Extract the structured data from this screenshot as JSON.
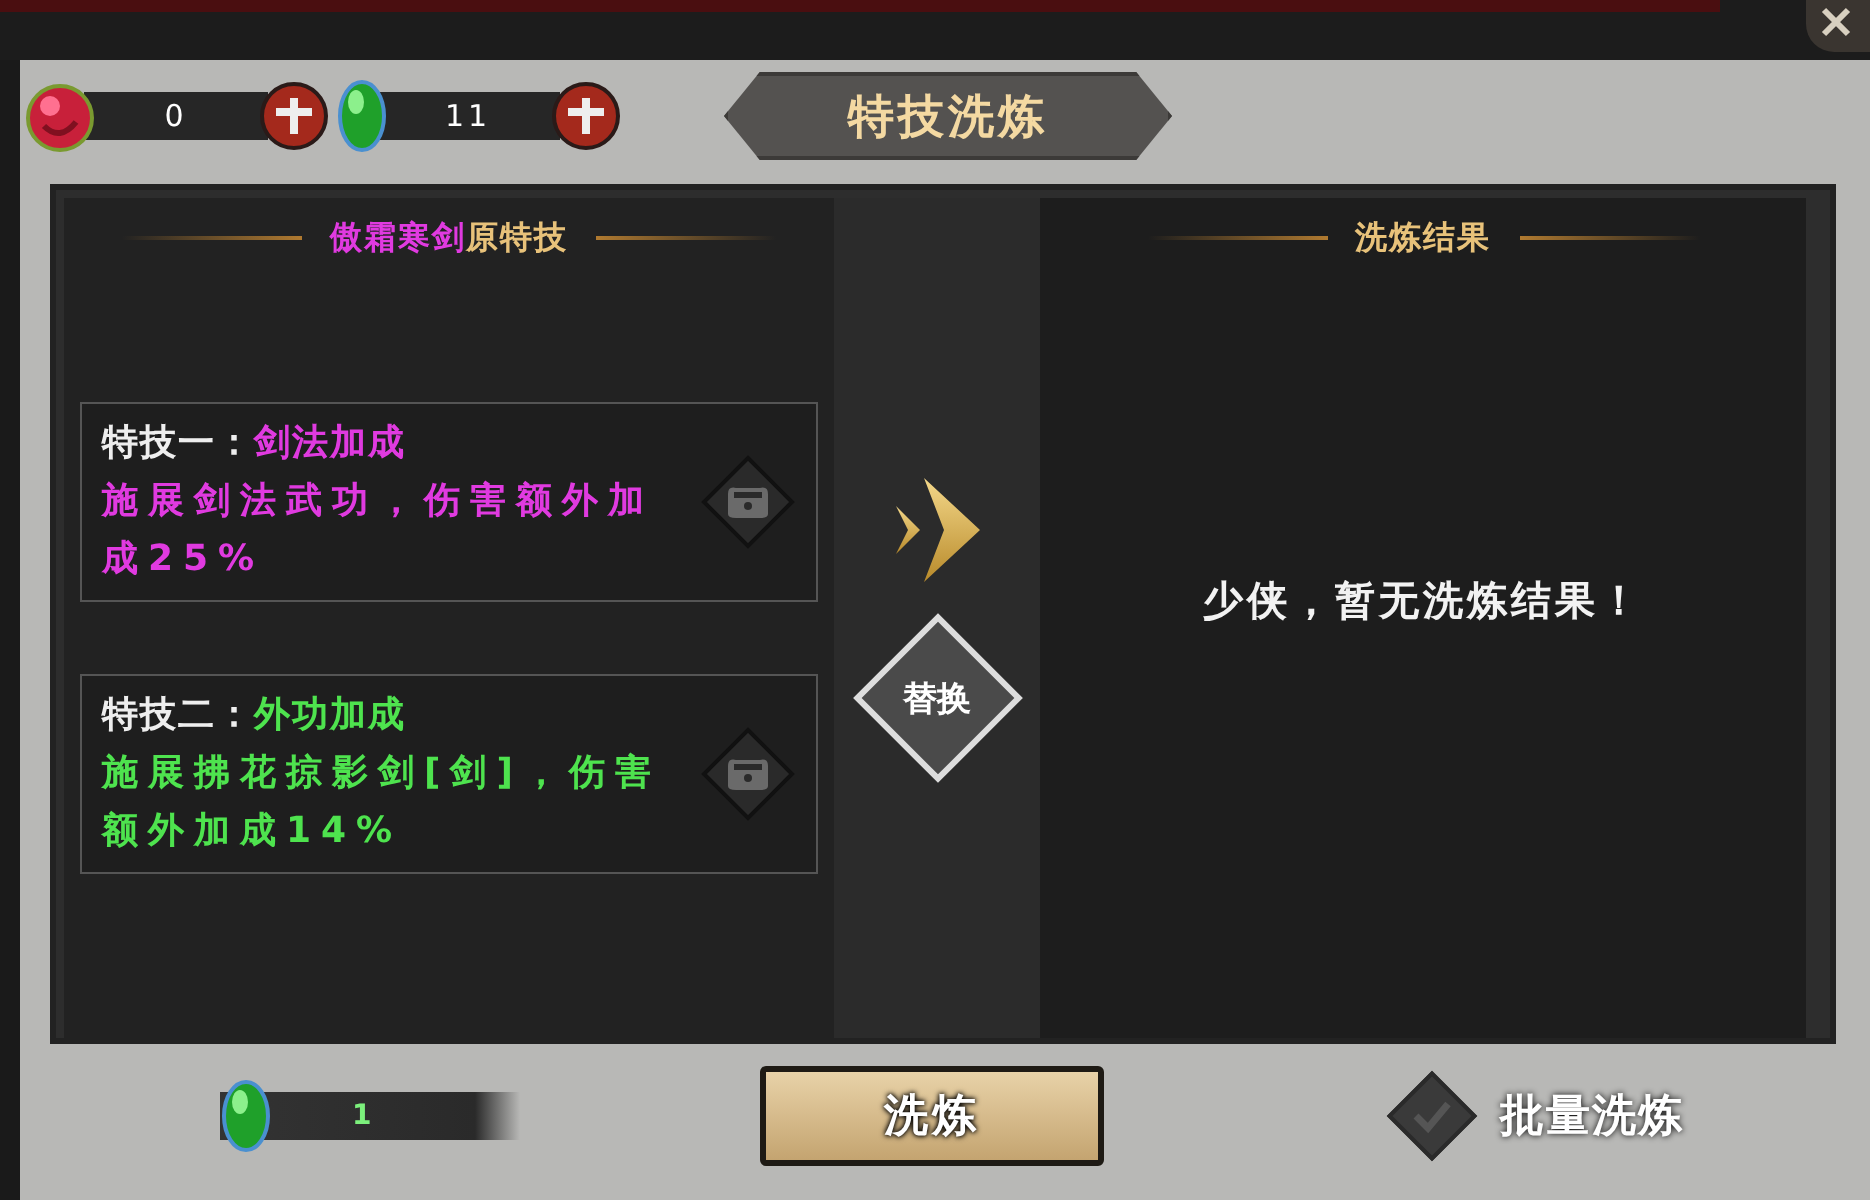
{
  "currencies": [
    {
      "kind": "red",
      "amount": "0"
    },
    {
      "kind": "green",
      "amount": "11"
    }
  ],
  "title": "特技洗炼",
  "original": {
    "title": {
      "weapon": "傲霜寒剑",
      "suffix": "原特技"
    },
    "skills": [
      {
        "label": "特技一：",
        "name": "剑法加成",
        "description": "施展剑法武功，伤害额外加成25%",
        "color": "#e03ae0"
      },
      {
        "label": "特技二：",
        "name": "外功加成",
        "description": "施展拂花掠影剑[剑]，伤害额外加成14%",
        "color": "#4ee34e"
      }
    ]
  },
  "replace_button": "替换",
  "result": {
    "title": "洗炼结果",
    "message": "少侠，暂无洗炼结果！"
  },
  "cost": {
    "kind": "green",
    "amount": "1"
  },
  "refine_button": "洗炼",
  "batch": {
    "label": "批量洗炼",
    "checked": false
  }
}
